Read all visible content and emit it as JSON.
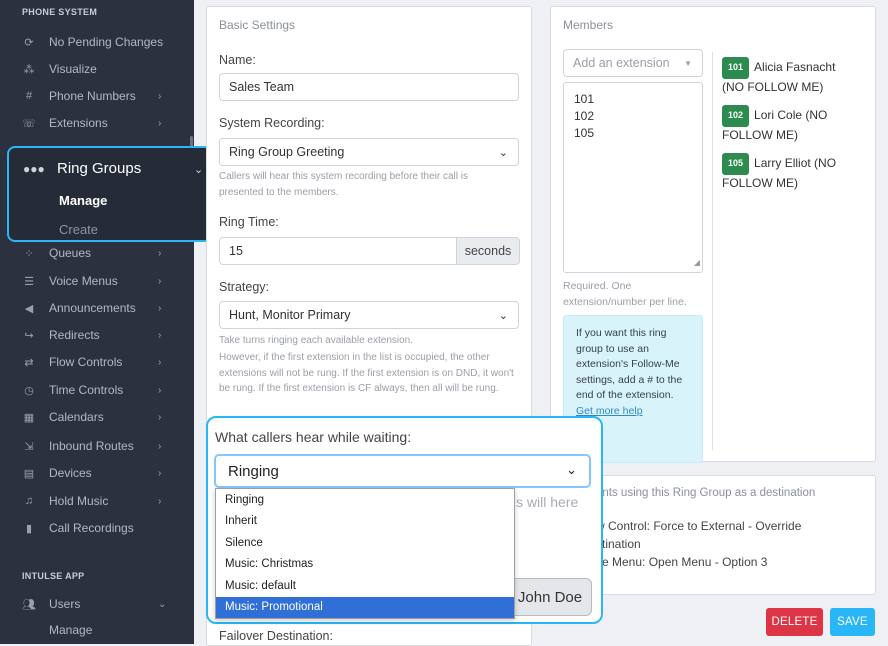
{
  "sidebar": {
    "section_phone": "PHONE SYSTEM",
    "items_top": [
      {
        "icon": "refresh-icon",
        "label": "No Pending Changes",
        "chevron": false
      },
      {
        "icon": "network-icon",
        "label": "Visualize",
        "chevron": false
      },
      {
        "icon": "phone-hash-icon",
        "label": "Phone Numbers",
        "chevron": true
      },
      {
        "icon": "extension-phone-icon",
        "label": "Extensions",
        "chevron": true
      }
    ],
    "ring_groups": {
      "label": "Ring Groups",
      "manage": "Manage",
      "create": "Create"
    },
    "items_bottom": [
      {
        "icon": "queue-icon",
        "label": "Queues"
      },
      {
        "icon": "menu-list-icon",
        "label": "Voice Menus"
      },
      {
        "icon": "megaphone-icon",
        "label": "Announcements"
      },
      {
        "icon": "redirect-icon",
        "label": "Redirects"
      },
      {
        "icon": "flow-icon",
        "label": "Flow Controls"
      },
      {
        "icon": "clock-icon",
        "label": "Time Controls"
      },
      {
        "icon": "calendar-icon",
        "label": "Calendars"
      },
      {
        "icon": "inbound-icon",
        "label": "Inbound Routes"
      },
      {
        "icon": "devices-icon",
        "label": "Devices"
      },
      {
        "icon": "music-icon",
        "label": "Hold Music"
      },
      {
        "icon": "recording-icon",
        "label": "Call Recordings"
      }
    ],
    "section_app": "INTULSE APP",
    "users": {
      "label": "Users",
      "manage": "Manage"
    }
  },
  "basic": {
    "title": "Basic Settings",
    "name_label": "Name:",
    "name_value": "Sales Team",
    "recording_label": "System Recording:",
    "recording_value": "Ring Group Greeting",
    "recording_help": "Callers will hear this system recording before their call is presented to the members.",
    "ring_time_label": "Ring Time:",
    "ring_time_value": "15",
    "ring_time_unit": "seconds",
    "strategy_label": "Strategy:",
    "strategy_value": "Hunt, Monitor Primary",
    "strategy_help1": "Take turns ringing each available extension.",
    "strategy_help2": "However, if the first extension in the list is occupied, the other extensions will not be rung. If the first extension is on DND, it won't be rung. If the first extension is CF always, then all will be rung.",
    "waiting_label": "What callers hear while waiting:",
    "waiting_value": "Ringing",
    "waiting_options": [
      "Ringing",
      "Inherit",
      "Silence",
      "Music: Christmas",
      "Music: default",
      "Music: Promotional"
    ],
    "behind_text": "s will here",
    "behind_button": "John Doe",
    "failover_label": "Failover Destination:"
  },
  "members": {
    "title": "Members",
    "add_placeholder": "Add an extension",
    "textarea_lines": [
      "101",
      "102",
      "105"
    ],
    "help": "Required. One extension/number per line.",
    "info_text": "If you want this ring group to use an extension's Follow-Me settings, add a # to the end of the extension.",
    "info_link": "Get more help",
    "list": [
      {
        "ext": "101",
        "name": "Alicia Fasnacht (NO FOLLOW ME)"
      },
      {
        "ext": "102",
        "name": "Lori Cole (NO FOLLOW ME)"
      },
      {
        "ext": "105",
        "name": "Larry Elliot (NO FOLLOW ME)"
      }
    ]
  },
  "destinations": {
    "title": "ents using this Ring Group as a destination",
    "lines": [
      "w Control: Force to External - Override",
      "stination",
      "ce Menu: Open Menu - Option 3"
    ]
  },
  "actions": {
    "delete": "DELETE",
    "save": "SAVE"
  },
  "colors": {
    "accent_highlight": "#29b6f6",
    "badge_green": "#2e8b4f",
    "delete_red": "#dc3545",
    "save_blue": "#29b6f6",
    "sidebar_bg": "#2c3140"
  }
}
